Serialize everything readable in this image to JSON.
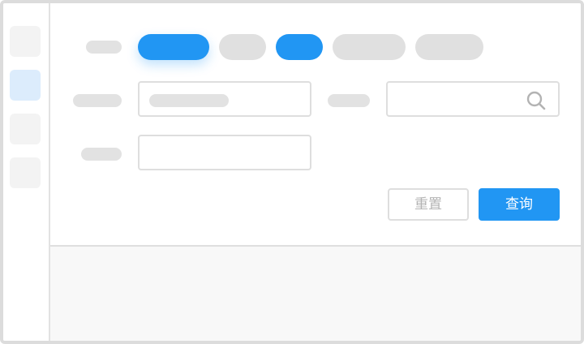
{
  "colors": {
    "accent": "#2196f3",
    "placeholder": "#e2e2e2",
    "sidebar_active": "#dcecfc",
    "border": "#dedede",
    "muted_text": "#b3b3b3"
  },
  "sidebar": {
    "items": [
      {
        "state": "default"
      },
      {
        "state": "active"
      },
      {
        "state": "default"
      },
      {
        "state": "default"
      }
    ]
  },
  "filters": {
    "chips": [
      {
        "state": "selected"
      },
      {
        "state": "default"
      },
      {
        "state": "selected"
      },
      {
        "state": "default"
      },
      {
        "state": "default"
      }
    ],
    "search_icon": "search-icon"
  },
  "actions": {
    "reset_label": "重置",
    "query_label": "查询"
  }
}
